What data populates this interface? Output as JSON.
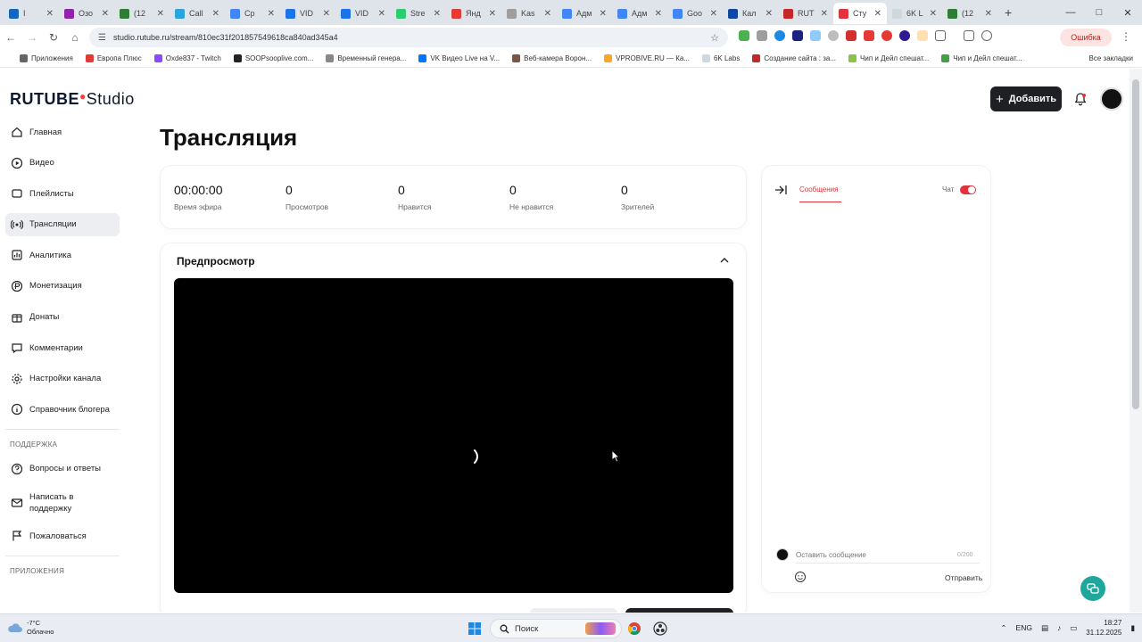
{
  "browser": {
    "tabs": [
      {
        "label": "I",
        "color": "#1565c0"
      },
      {
        "label": "Озо",
        "color": "#8e24aa"
      },
      {
        "label": "(12",
        "color": "#2e7d32"
      },
      {
        "label": "Call",
        "color": "#2aa3df"
      },
      {
        "label": "Ср",
        "color": "#4285f4"
      },
      {
        "label": "VID",
        "color": "#1a73e8"
      },
      {
        "label": "VID",
        "color": "#1a73e8"
      },
      {
        "label": "Stre",
        "color": "#2ecc71"
      },
      {
        "label": "Янд",
        "color": "#e53935"
      },
      {
        "label": "Kas",
        "color": "#9e9e9e"
      },
      {
        "label": "Адм",
        "color": "#4285f4"
      },
      {
        "label": "Адм",
        "color": "#4285f4"
      },
      {
        "label": "Goo",
        "color": "#4285f4"
      },
      {
        "label": "Кал",
        "color": "#0d47a1"
      },
      {
        "label": "RUT",
        "color": "#c62828"
      },
      {
        "label": "Сту",
        "color": "#e2323c",
        "active": true
      },
      {
        "label": "6K L",
        "color": "#cfd8dc"
      },
      {
        "label": "(12",
        "color": "#2e7d32"
      }
    ],
    "url": "studio.rutube.ru/stream/810ec31f201857549618ca840ad345a4",
    "error_label": "Ошибка",
    "bookmarks": [
      {
        "label": "Приложения",
        "color": "#666666"
      },
      {
        "label": "Европа Плюс",
        "color": "#e53935"
      },
      {
        "label": "Oxde837 - Twitch",
        "color": "#9146ff"
      },
      {
        "label": "SOOPsooplive.com...",
        "color": "#222222"
      },
      {
        "label": "Временный генера...",
        "color": "#888888"
      },
      {
        "label": "VK Видео Live на V...",
        "color": "#0077ff"
      },
      {
        "label": "Веб-камера Ворон...",
        "color": "#795548"
      },
      {
        "label": "VPROBIVE.RU — Ка...",
        "color": "#f9a825"
      },
      {
        "label": "6K Labs",
        "color": "#cfd8dc"
      },
      {
        "label": "Создание сайта : за...",
        "color": "#c62828"
      },
      {
        "label": "Чип и Дейл спешат...",
        "color": "#8bc34a"
      },
      {
        "label": "Чип и Дейл спешат...",
        "color": "#43a047"
      }
    ],
    "all_bookmarks": "Все закладки"
  },
  "header": {
    "logo_main": "RUTUBE",
    "logo_studio": "Studio",
    "add_button": "Добавить"
  },
  "sidebar": {
    "items": [
      {
        "label": "Главная",
        "icon": "home-icon"
      },
      {
        "label": "Видео",
        "icon": "video-icon"
      },
      {
        "label": "Плейлисты",
        "icon": "playlist-icon"
      },
      {
        "label": "Трансляции",
        "icon": "broadcast-icon",
        "active": true
      },
      {
        "label": "Аналитика",
        "icon": "analytics-icon"
      },
      {
        "label": "Монетизация",
        "icon": "monetization-icon"
      },
      {
        "label": "Донаты",
        "icon": "donate-icon"
      },
      {
        "label": "Комментарии",
        "icon": "comment-icon"
      },
      {
        "label": "Настройки канала",
        "icon": "settings-icon"
      },
      {
        "label": "Справочник блогера",
        "icon": "info-icon"
      }
    ],
    "support_title": "ПОДДЕРЖКА",
    "support_items": [
      {
        "label": "Вопросы и ответы",
        "icon": "help-icon"
      },
      {
        "label": "Написать в поддержку",
        "icon": "mail-icon"
      },
      {
        "label": "Пожаловаться",
        "icon": "flag-icon"
      }
    ],
    "apps_title": "ПРИЛОЖЕНИЯ"
  },
  "main": {
    "title": "Трансляция",
    "stats": [
      {
        "value": "00:00:00",
        "label": "Время эфира"
      },
      {
        "value": "0",
        "label": "Просмотров"
      },
      {
        "value": "0",
        "label": "Нравится"
      },
      {
        "value": "0",
        "label": "Не нравится"
      },
      {
        "value": "0",
        "label": "Зрителей"
      }
    ],
    "preview_title": "Предпросмотр"
  },
  "chat": {
    "tab_label": "Сообщения",
    "toggle_label": "Чат",
    "toggle_on": true,
    "input_placeholder": "Оставить сообщение",
    "counter": "0/200",
    "send_label": "Отправить",
    "accent_color": "#e2323c"
  },
  "taskbar": {
    "temperature": "-7°C",
    "weather": "Облачно",
    "search_placeholder": "Поиск",
    "language": "ENG",
    "time": "18:27",
    "date": "31.12.2025"
  }
}
